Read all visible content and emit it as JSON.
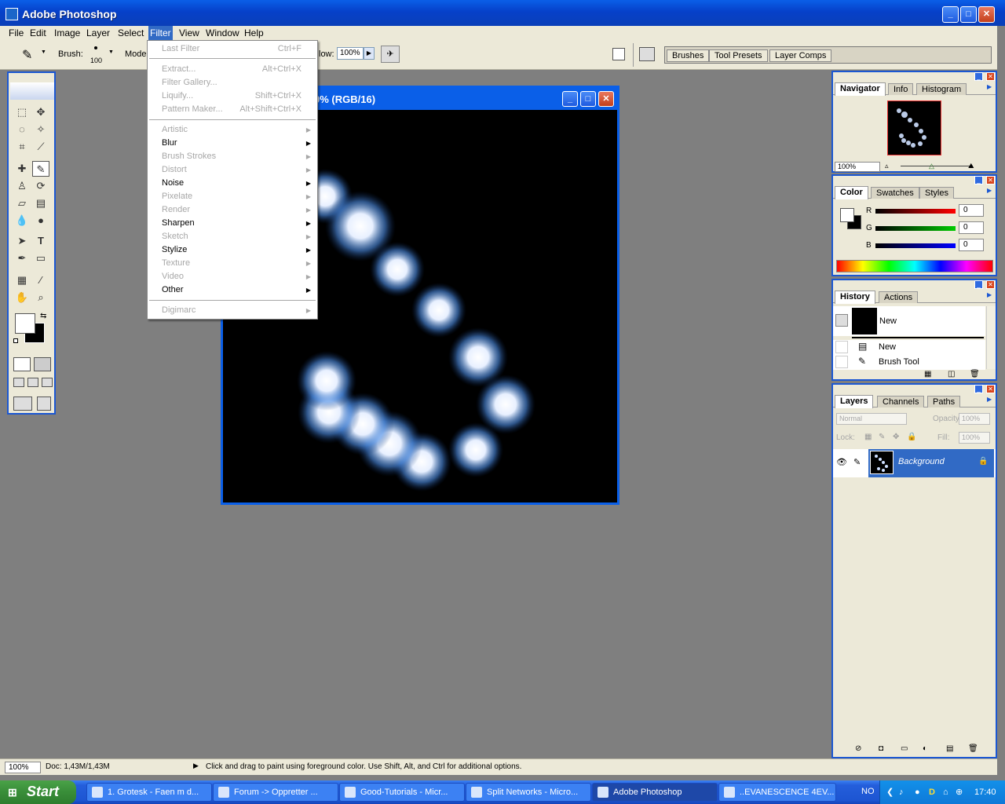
{
  "app": {
    "title": "Adobe Photoshop"
  },
  "menubar": [
    "File",
    "Edit",
    "Image",
    "Layer",
    "Select",
    "Filter",
    "View",
    "Window",
    "Help"
  ],
  "options": {
    "brush_label": "Brush:",
    "brush_size": "100",
    "mode_label": "Mode",
    "flow_label": "low:",
    "flow_value": "100%"
  },
  "palette_well": [
    "Brushes",
    "Tool Presets",
    "Layer Comps"
  ],
  "document": {
    "title": "0% (RGB/16)"
  },
  "filter_menu": {
    "last_filter": {
      "label": "Last Filter",
      "shortcut": "Ctrl+F"
    },
    "extract": {
      "label": "Extract...",
      "shortcut": "Alt+Ctrl+X"
    },
    "filter_gallery": {
      "label": "Filter Gallery..."
    },
    "liquify": {
      "label": "Liquify...",
      "shortcut": "Shift+Ctrl+X"
    },
    "pattern_maker": {
      "label": "Pattern Maker...",
      "shortcut": "Alt+Shift+Ctrl+X"
    },
    "submenus": [
      {
        "label": "Artistic",
        "enabled": false
      },
      {
        "label": "Blur",
        "enabled": true
      },
      {
        "label": "Brush Strokes",
        "enabled": false
      },
      {
        "label": "Distort",
        "enabled": false
      },
      {
        "label": "Noise",
        "enabled": true
      },
      {
        "label": "Pixelate",
        "enabled": false
      },
      {
        "label": "Render",
        "enabled": false
      },
      {
        "label": "Sharpen",
        "enabled": true
      },
      {
        "label": "Sketch",
        "enabled": false
      },
      {
        "label": "Stylize",
        "enabled": true
      },
      {
        "label": "Texture",
        "enabled": false
      },
      {
        "label": "Video",
        "enabled": false
      },
      {
        "label": "Other",
        "enabled": true
      }
    ],
    "digimarc": {
      "label": "Digimarc"
    }
  },
  "navigator": {
    "tabs": [
      "Navigator",
      "Info",
      "Histogram"
    ],
    "zoom": "100%"
  },
  "color_panel": {
    "tabs": [
      "Color",
      "Swatches",
      "Styles"
    ],
    "r_label": "R",
    "g_label": "G",
    "b_label": "B",
    "r": "0",
    "g": "0",
    "b": "0"
  },
  "history_panel": {
    "tabs": [
      "History",
      "Actions"
    ],
    "snapshot": "New",
    "items": [
      "New",
      "Brush Tool"
    ]
  },
  "layers_panel": {
    "tabs": [
      "Layers",
      "Channels",
      "Paths"
    ],
    "blend_mode": "Normal",
    "opacity_label": "Opacity:",
    "opacity": "100%",
    "lock_label": "Lock:",
    "fill_label": "Fill:",
    "fill": "100%",
    "layer_name": "Background"
  },
  "status": {
    "zoom": "100%",
    "doc": "Doc: 1,43M/1,43M",
    "hint": "Click and drag to paint using foreground color.  Use Shift, Alt, and Ctrl for additional options."
  },
  "taskbar": {
    "start": "Start",
    "tasks": [
      "1. Grotesk - Faen m d...",
      "Forum -> Oppretter ...",
      "Good-Tutorials - Micr...",
      "Split Networks - Micro...",
      "Adobe Photoshop",
      "..EVANESCENCE 4EV..."
    ],
    "lang": "NO",
    "clock": "17:40"
  },
  "colors": {
    "xp_blue": "#0a5fe8",
    "menu_highlight": "#316ac5",
    "panel_bg": "#ece9d8",
    "workspace": "#7f7f7f"
  }
}
